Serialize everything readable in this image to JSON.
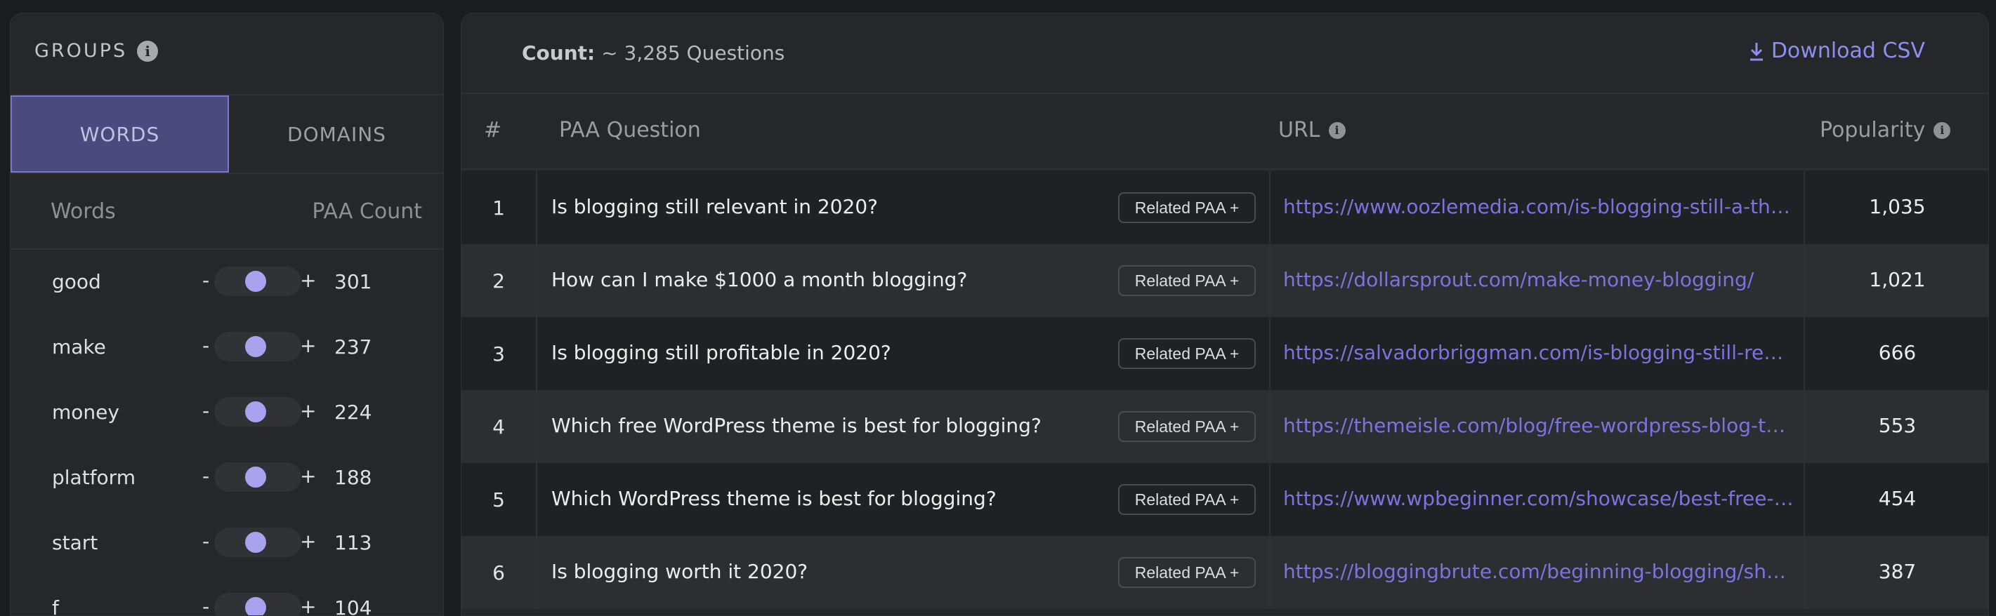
{
  "groups": {
    "title": "GROUPS",
    "tabs": [
      {
        "label": "WORDS",
        "active": true
      },
      {
        "label": "DOMAINS",
        "active": false
      }
    ],
    "columns": {
      "words": "Words",
      "count": "PAA Count"
    },
    "items": [
      {
        "word": "good",
        "count": "301"
      },
      {
        "word": "make",
        "count": "237"
      },
      {
        "word": "money",
        "count": "224"
      },
      {
        "word": "platform",
        "count": "188"
      },
      {
        "word": "start",
        "count": "113"
      },
      {
        "word": "f",
        "count": "104"
      }
    ],
    "minus": "-",
    "plus": "+"
  },
  "results": {
    "count_label": "Count:",
    "count_value": "~ 3,285 Questions",
    "download_label": "Download CSV",
    "columns": {
      "num": "#",
      "question": "PAA Question",
      "url": "URL",
      "popularity": "Popularity"
    },
    "related_label": "Related PAA +",
    "rows": [
      {
        "n": "1",
        "q": "Is blogging still relevant in 2020?",
        "url": "https://www.oozlemedia.com/is-blogging-still-a-thing/",
        "pop": "1,035"
      },
      {
        "n": "2",
        "q": "How can I make $1000 a month blogging?",
        "url": "https://dollarsprout.com/make-money-blogging/",
        "pop": "1,021"
      },
      {
        "n": "3",
        "q": "Is blogging still profitable in 2020?",
        "url": "https://salvadorbriggman.com/is-blogging-still-really-profitable/",
        "pop": "666"
      },
      {
        "n": "4",
        "q": "Which free WordPress theme is best for blogging?",
        "url": "https://themeisle.com/blog/free-wordpress-blog-themes/",
        "pop": "553"
      },
      {
        "n": "5",
        "q": "Which WordPress theme is best for blogging?",
        "url": "https://www.wpbeginner.com/showcase/best-free-wordpress-blog-themes/",
        "pop": "454"
      },
      {
        "n": "6",
        "q": "Is blogging worth it 2020?",
        "url": "https://bloggingbrute.com/beginning-blogging/should-you-start-a-blog/",
        "pop": "387"
      }
    ]
  },
  "colors": {
    "accent": "#7b74e0",
    "tab_active_bg": "#4a4a7e",
    "slider_knob": "#a7a3ee",
    "panel_bg": "#25272a"
  }
}
